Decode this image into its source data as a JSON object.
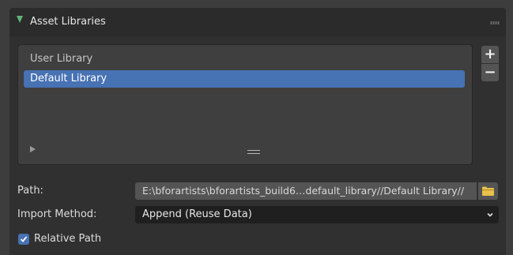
{
  "panel": {
    "title": "Asset Libraries",
    "expanded": true
  },
  "library_list": {
    "items": [
      {
        "label": "User Library",
        "selected": false
      },
      {
        "label": "Default Library",
        "selected": true
      }
    ],
    "add_button_label": "+",
    "remove_button_label": "−"
  },
  "path": {
    "label": "Path:",
    "value": "E:\\bforartists\\bforartists_build6…default_library//Default Library//"
  },
  "import_method": {
    "label": "Import Method:",
    "value": "Append (Reuse Data)"
  },
  "relative_path": {
    "label": "Relative Path",
    "checked": true
  },
  "colors": {
    "accent": "#4772b3",
    "disclosure": "#62b37a",
    "folder_icon": "#e8c04a"
  }
}
